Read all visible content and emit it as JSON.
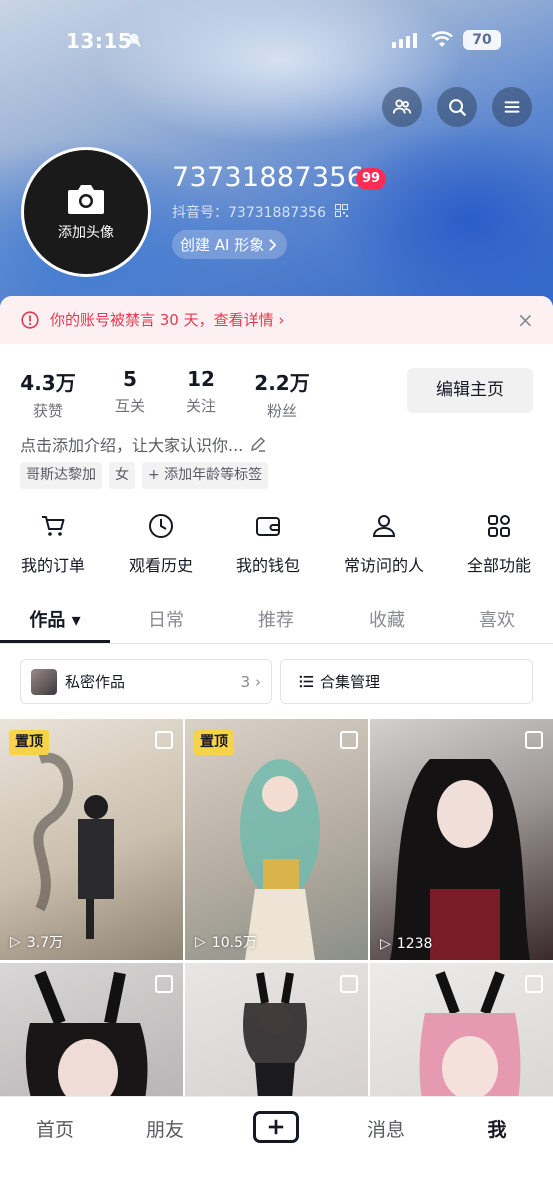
{
  "status_bar": {
    "time": "13:15",
    "battery": "70"
  },
  "profile": {
    "avatar_label": "添加头像",
    "username": "73731887356",
    "badge": "99",
    "douyin_id": "抖音号：73731887356",
    "ai_button": "创建 AI 形象"
  },
  "warning": {
    "text": "你的账号被禁言 30 天，查看详情"
  },
  "stats": [
    {
      "value": "4.3万",
      "label": "获赞"
    },
    {
      "value": "5",
      "label": "互关"
    },
    {
      "value": "12",
      "label": "关注"
    },
    {
      "value": "2.2万",
      "label": "粉丝"
    }
  ],
  "edit_button": "编辑主页",
  "bio": "点击添加介绍，让大家认识你...",
  "tags": [
    "哥斯达黎加",
    "女",
    "+ 添加年龄等标签"
  ],
  "functions": [
    {
      "label": "我的订单",
      "icon": "cart-icon"
    },
    {
      "label": "观看历史",
      "icon": "clock-icon"
    },
    {
      "label": "我的钱包",
      "icon": "wallet-icon"
    },
    {
      "label": "常访问的人",
      "icon": "person-icon"
    },
    {
      "label": "全部功能",
      "icon": "grid-icon"
    }
  ],
  "tabs": [
    "作品",
    "日常",
    "推荐",
    "收藏",
    "喜欢"
  ],
  "private_works": {
    "label": "私密作品",
    "count": "3"
  },
  "collection_manage": "合集管理",
  "videos": [
    {
      "pinned": "置顶",
      "plays": "3.7万"
    },
    {
      "pinned": "置顶",
      "plays": "10.5万"
    },
    {
      "plays": "1238"
    },
    {},
    {},
    {}
  ],
  "bottom_nav": [
    "首页",
    "朋友",
    "消息",
    "我"
  ],
  "colors": {
    "accent": "#fe2c55",
    "pin": "#f9d347"
  }
}
